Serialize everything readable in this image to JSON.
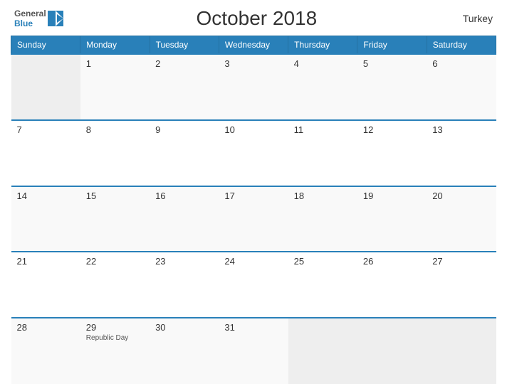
{
  "header": {
    "logo_general": "General",
    "logo_blue": "Blue",
    "title": "October 2018",
    "country": "Turkey"
  },
  "weekdays": [
    "Sunday",
    "Monday",
    "Tuesday",
    "Wednesday",
    "Thursday",
    "Friday",
    "Saturday"
  ],
  "weeks": [
    [
      {
        "num": "",
        "holiday": "",
        "empty": true
      },
      {
        "num": "1",
        "holiday": "",
        "empty": false
      },
      {
        "num": "2",
        "holiday": "",
        "empty": false
      },
      {
        "num": "3",
        "holiday": "",
        "empty": false
      },
      {
        "num": "4",
        "holiday": "",
        "empty": false
      },
      {
        "num": "5",
        "holiday": "",
        "empty": false
      },
      {
        "num": "6",
        "holiday": "",
        "empty": false
      }
    ],
    [
      {
        "num": "7",
        "holiday": "",
        "empty": false
      },
      {
        "num": "8",
        "holiday": "",
        "empty": false
      },
      {
        "num": "9",
        "holiday": "",
        "empty": false
      },
      {
        "num": "10",
        "holiday": "",
        "empty": false
      },
      {
        "num": "11",
        "holiday": "",
        "empty": false
      },
      {
        "num": "12",
        "holiday": "",
        "empty": false
      },
      {
        "num": "13",
        "holiday": "",
        "empty": false
      }
    ],
    [
      {
        "num": "14",
        "holiday": "",
        "empty": false
      },
      {
        "num": "15",
        "holiday": "",
        "empty": false
      },
      {
        "num": "16",
        "holiday": "",
        "empty": false
      },
      {
        "num": "17",
        "holiday": "",
        "empty": false
      },
      {
        "num": "18",
        "holiday": "",
        "empty": false
      },
      {
        "num": "19",
        "holiday": "",
        "empty": false
      },
      {
        "num": "20",
        "holiday": "",
        "empty": false
      }
    ],
    [
      {
        "num": "21",
        "holiday": "",
        "empty": false
      },
      {
        "num": "22",
        "holiday": "",
        "empty": false
      },
      {
        "num": "23",
        "holiday": "",
        "empty": false
      },
      {
        "num": "24",
        "holiday": "",
        "empty": false
      },
      {
        "num": "25",
        "holiday": "",
        "empty": false
      },
      {
        "num": "26",
        "holiday": "",
        "empty": false
      },
      {
        "num": "27",
        "holiday": "",
        "empty": false
      }
    ],
    [
      {
        "num": "28",
        "holiday": "",
        "empty": false
      },
      {
        "num": "29",
        "holiday": "Republic Day",
        "empty": false
      },
      {
        "num": "30",
        "holiday": "",
        "empty": false
      },
      {
        "num": "31",
        "holiday": "",
        "empty": false
      },
      {
        "num": "",
        "holiday": "",
        "empty": true
      },
      {
        "num": "",
        "holiday": "",
        "empty": true
      },
      {
        "num": "",
        "holiday": "",
        "empty": true
      }
    ]
  ]
}
